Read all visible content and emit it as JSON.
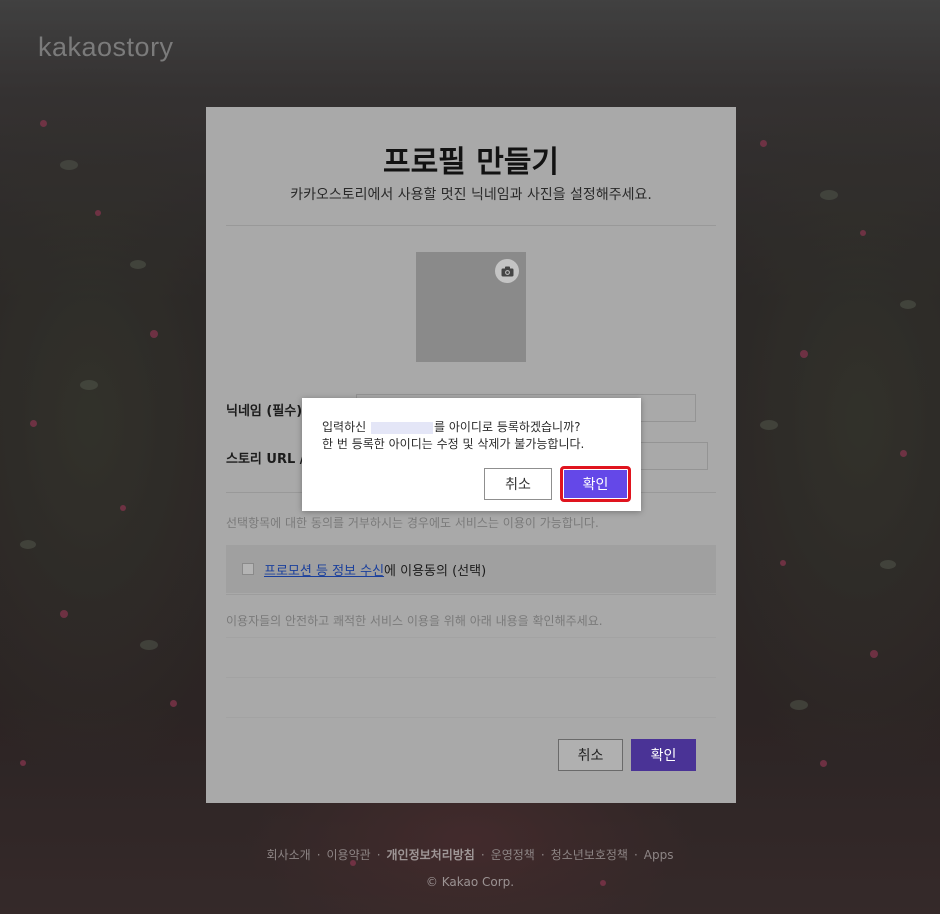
{
  "brand": {
    "logo_text": "kakaostory"
  },
  "profile": {
    "title": "프로필 만들기",
    "subtitle": "카카오스토리에서 사용할 멋진 닉네임과 사진을 설정해주세요.",
    "nickname_label": "닉네임 (필수)",
    "story_url_label": "스토리 URL /",
    "optional_notice": "선택항목에 대한 동의를 거부하시는 경우에도 서비스는 이용이 가능합니다.",
    "consent_link": "프로모션 등 정보 수신",
    "consent_rest": "에 이용동의 (선택)",
    "safety_notice": "이용자들의 안전하고 쾌적한 서비스 이용을 위해 아래 내용을 확인해주세요.",
    "cancel_label": "취소",
    "confirm_label": "확인",
    "camera_icon": "camera-icon"
  },
  "dialog": {
    "line1_before": "입력하신",
    "line1_after": "를 아이디로 등록하겠습니까?",
    "line2": "한 번 등록한 아이디는 수정 및 삭제가 불가능합니다.",
    "cancel_label": "취소",
    "confirm_label": "확인",
    "highlight_color": "#e0141e",
    "confirm_color": "#6448e8"
  },
  "footer": {
    "links": [
      "회사소개",
      "이용약관",
      "개인정보처리방침",
      "운영정책",
      "청소년보호정책",
      "Apps"
    ],
    "separator": "·",
    "copyright": "© Kakao Corp."
  }
}
